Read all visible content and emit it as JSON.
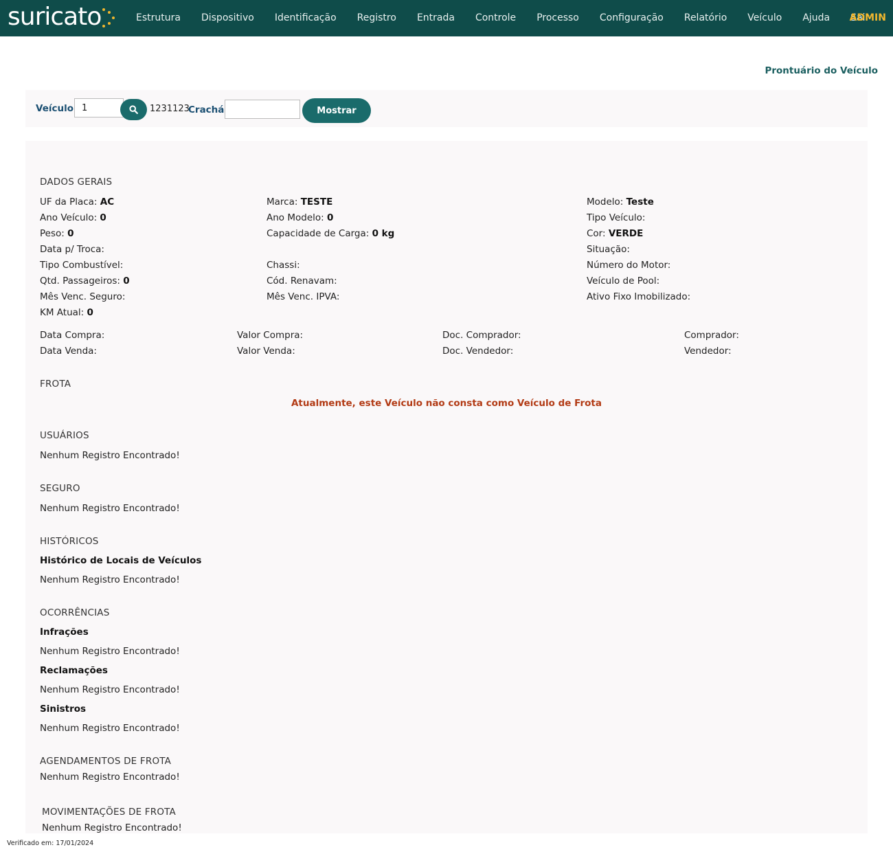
{
  "nav": {
    "logo": "suricato",
    "items": [
      "Estrutura",
      "Dispositivo",
      "Identificação",
      "Registro",
      "Entrada",
      "Controle",
      "Processo",
      "Configuração",
      "Relatório",
      "Veículo",
      "Ajuda",
      "Sair"
    ],
    "user": "ADMIN"
  },
  "page_title": "Prontuário do Veículo",
  "search": {
    "veiculo_label": "Veículo",
    "veiculo_value": "1",
    "search_icon": "search-icon",
    "veiculo_code": "1231123",
    "cracha_label": "Crachá",
    "cracha_value": "",
    "show_button": "Mostrar"
  },
  "dados_gerais": {
    "title": "DADOS GERAIS",
    "col1": [
      {
        "label": "UF da Placa:",
        "value": "AC"
      },
      {
        "label": "Ano Veículo:",
        "value": "0"
      },
      {
        "label": "Peso:",
        "value": "0"
      },
      {
        "label": "Data p/ Troca:",
        "value": ""
      },
      {
        "label": "Tipo Combustível:",
        "value": ""
      },
      {
        "label": "Qtd. Passageiros:",
        "value": "0"
      },
      {
        "label": "Mês Venc. Seguro:",
        "value": ""
      },
      {
        "label": "KM Atual:",
        "value": "0"
      }
    ],
    "col2": [
      {
        "label": "Marca:",
        "value": "TESTE"
      },
      {
        "label": "Ano Modelo:",
        "value": "0"
      },
      {
        "label": "Capacidade de Carga:",
        "value": "0 kg"
      },
      {
        "label": "",
        "value": ""
      },
      {
        "label": "Chassi:",
        "value": ""
      },
      {
        "label": "Cód. Renavam:",
        "value": ""
      },
      {
        "label": "Mês Venc. IPVA:",
        "value": ""
      }
    ],
    "col3": [
      {
        "label": "Modelo:",
        "value": "Teste"
      },
      {
        "label": "Tipo Veículo:",
        "value": ""
      },
      {
        "label": "Cor:",
        "value": "VERDE"
      },
      {
        "label": "Situação:",
        "value": ""
      },
      {
        "label": "Número do Motor:",
        "value": ""
      },
      {
        "label": "Veículo de Pool:",
        "value": ""
      },
      {
        "label": "Ativo Fixo Imobilizado:",
        "value": ""
      }
    ],
    "compra": {
      "data_compra": "Data Compra:",
      "valor_compra": "Valor Compra:",
      "doc_comprador": "Doc. Comprador:",
      "comprador": "Comprador:",
      "data_venda": "Data Venda:",
      "valor_venda": "Valor Venda:",
      "doc_vendedor": "Doc. Vendedor:",
      "vendedor": "Vendedor:"
    }
  },
  "frota": {
    "title": "FROTA",
    "message": "Atualmente, este Veículo não consta como Veículo de Frota"
  },
  "usuarios": {
    "title": "USUÁRIOS",
    "empty": "Nenhum Registro Encontrado!"
  },
  "seguro": {
    "title": "SEGURO",
    "empty": "Nenhum Registro Encontrado!"
  },
  "historicos": {
    "title": "HISTÓRICOS",
    "sub": "Histórico de Locais de Veículos",
    "empty": "Nenhum Registro Encontrado!"
  },
  "ocorrencias": {
    "title": "OCORRÊNCIAS",
    "infracoes": "Infrações",
    "infracoes_empty": "Nenhum Registro Encontrado!",
    "reclamacoes": "Reclamações",
    "reclamacoes_empty": "Nenhum Registro Encontrado!",
    "sinistros": "Sinistros",
    "sinistros_empty": "Nenhum Registro Encontrado!"
  },
  "agendamentos": {
    "title": "AGENDAMENTOS DE FROTA",
    "empty": "Nenhum Registro Encontrado!"
  },
  "movimentacoes": {
    "title": "MOVIMENTAÇÕES DE FROTA",
    "empty": "Nenhum Registro Encontrado!"
  },
  "footer": "Verificado em: 17/01/2024",
  "colors": {
    "nav": "#0f4c4a",
    "accent": "#1a6b6b",
    "warning": "#b23a14",
    "admin": "#f2b72e"
  }
}
